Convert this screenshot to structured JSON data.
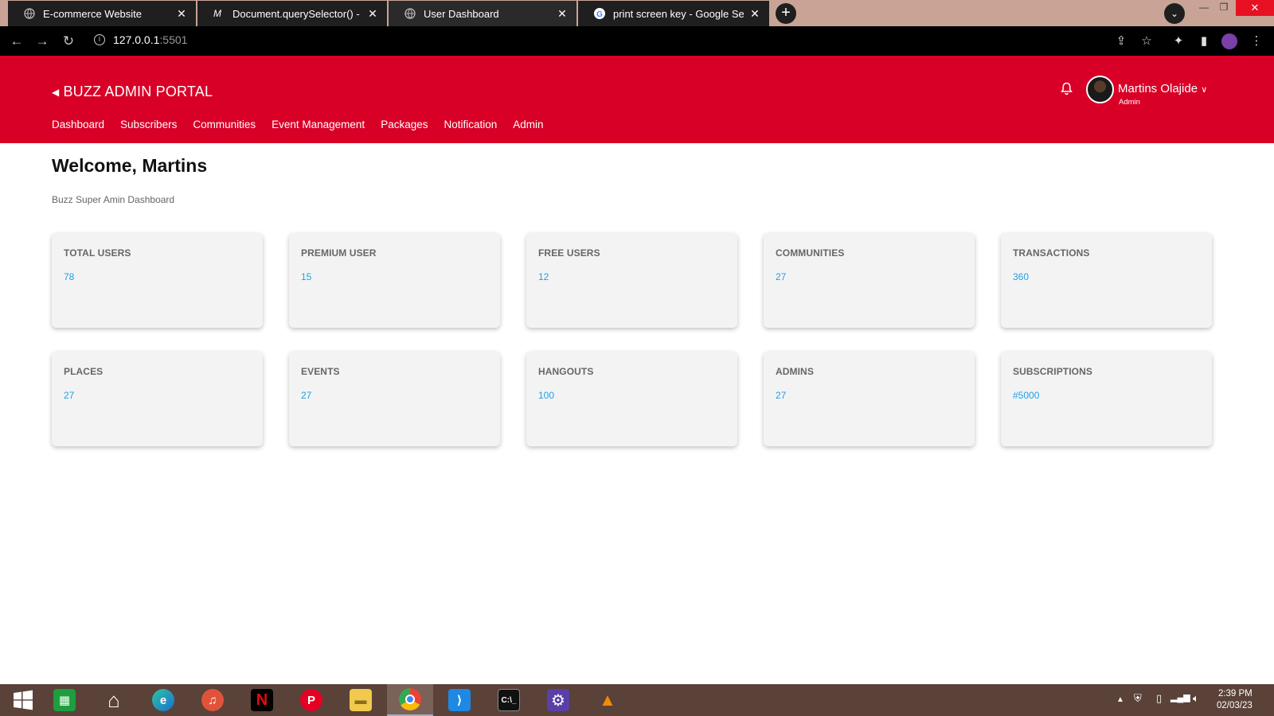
{
  "browser": {
    "tabs": [
      {
        "title": "E-commerce Website",
        "icon": "globe-icon"
      },
      {
        "title": "Document.querySelector() - Web",
        "icon": "mdn-icon"
      },
      {
        "title": "User Dashboard",
        "icon": "globe-icon"
      },
      {
        "title": "print screen key - Google Search",
        "icon": "google-icon"
      }
    ],
    "url": {
      "host": "127.0.0.1",
      "port": ":5501"
    }
  },
  "header": {
    "brand": "BUZZ ADMIN PORTAL",
    "nav": [
      "Dashboard",
      "Subscribers",
      "Communities",
      "Event Management",
      "Packages",
      "Notification",
      "Admin"
    ],
    "user": {
      "name": "Martins Olajide",
      "role": "Admin"
    }
  },
  "main": {
    "welcome": "Welcome, Martins",
    "subtitle": "Buzz Super Amin Dashboard",
    "cards": [
      {
        "label": "TOTAL USERS",
        "value": "78"
      },
      {
        "label": "PREMIUM USER",
        "value": "15"
      },
      {
        "label": "FREE USERS",
        "value": "12"
      },
      {
        "label": "COMMUNITIES",
        "value": "27"
      },
      {
        "label": "TRANSACTIONS",
        "value": "360"
      },
      {
        "label": "PLACES",
        "value": "27"
      },
      {
        "label": "EVENTS",
        "value": "27"
      },
      {
        "label": "HANGOUTS",
        "value": "100"
      },
      {
        "label": "ADMINS",
        "value": "27"
      },
      {
        "label": "SUBSCRIPTIONS",
        "value": "#5000"
      }
    ]
  },
  "taskbar": {
    "clock": {
      "time": "2:39 PM",
      "date": "02/03/23"
    }
  },
  "colors": {
    "brand_red": "#d80027",
    "value_blue": "#1ea0e8",
    "card_bg": "#f3f3f3"
  }
}
